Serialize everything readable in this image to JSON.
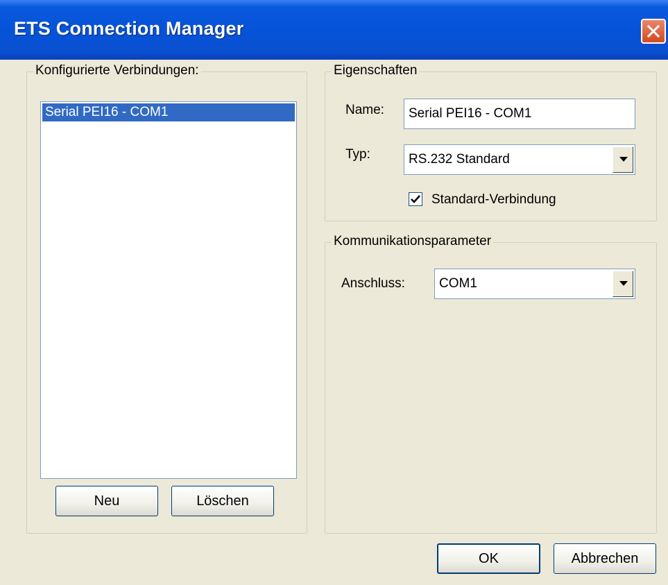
{
  "window": {
    "title": "ETS Connection Manager"
  },
  "connections": {
    "group_label": "Konfigurierte Verbindungen:",
    "items": [
      {
        "label": "Serial PEI16 - COM1",
        "selected": true
      }
    ],
    "new_button": "Neu",
    "delete_button": "Löschen"
  },
  "properties": {
    "group_label": "Eigenschaften",
    "name_label": "Name:",
    "name_value": "Serial PEI16 - COM1",
    "type_label": "Typ:",
    "type_value": "RS.232 Standard",
    "default_checkbox_label": "Standard-Verbindung",
    "default_checked": true
  },
  "communication": {
    "group_label": "Kommunikationsparameter",
    "port_label": "Anschluss:",
    "port_value": "COM1"
  },
  "footer": {
    "ok_button": "OK",
    "cancel_button": "Abbrechen"
  },
  "colors": {
    "titlebar": "#0553D8",
    "selection": "#316AC5",
    "face": "#ECE9D8"
  }
}
